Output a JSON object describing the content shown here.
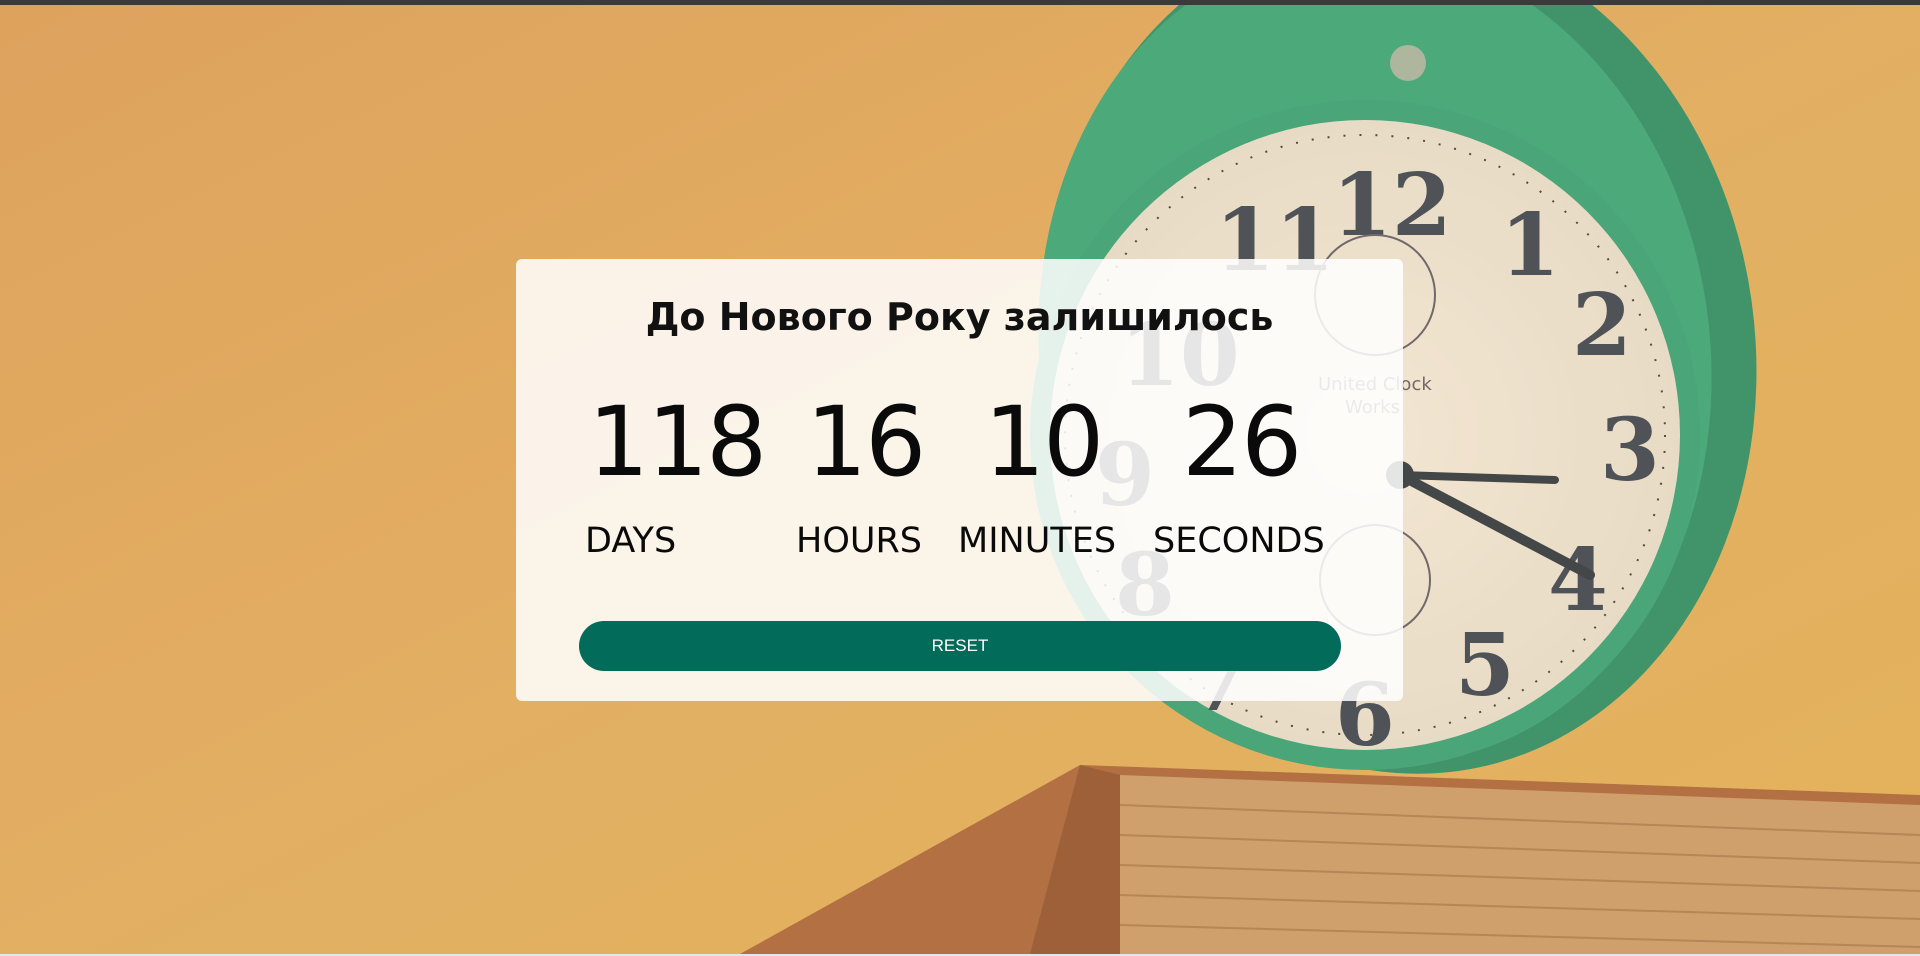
{
  "countdown": {
    "title": "До Нового Року залишилось",
    "days": {
      "value": "118",
      "label": "DAYS"
    },
    "hours": {
      "value": "16",
      "label": "HOURS"
    },
    "minutes": {
      "value": "10",
      "label": "MINUTES"
    },
    "seconds": {
      "value": "26",
      "label": "SECONDS"
    },
    "reset_label": "RESET"
  },
  "background": {
    "subject": "alarm-clock-on-book",
    "clock_text": "United Clock Works",
    "clock_numerals": [
      "12",
      "1",
      "2",
      "3",
      "4",
      "5",
      "6",
      "7",
      "8",
      "9",
      "10",
      "11"
    ]
  },
  "colors": {
    "background": "#dca657",
    "card": "#ffffff",
    "button": "#026b5a",
    "clock_rim": "#1f9a72"
  }
}
